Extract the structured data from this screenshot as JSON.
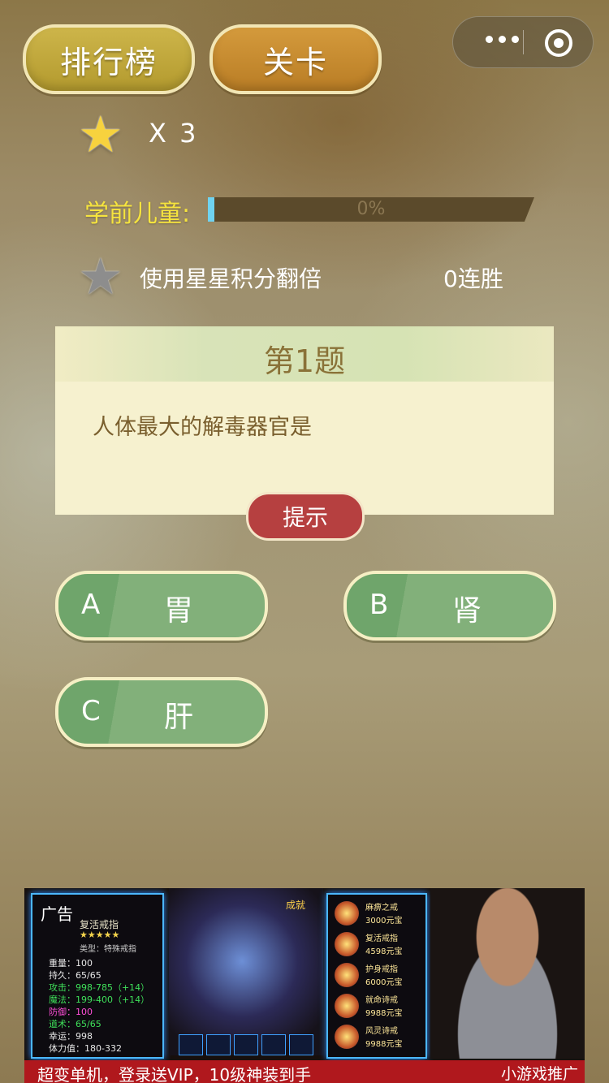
{
  "header": {
    "rank_label": "排行榜",
    "level_label": "关卡"
  },
  "capsule": {
    "more_icon": "more-dots-icon",
    "close_icon": "target-circle-icon"
  },
  "status": {
    "star_count": "X 3",
    "level_name": "学前儿童:",
    "progress_text": "0%",
    "progress_value": 0,
    "double_text": "使用星星积分翻倍",
    "streak_text": "0连胜"
  },
  "question": {
    "title": "第1题",
    "text": "人体最大的解毒器官是",
    "hint_label": "提示"
  },
  "answers": [
    {
      "letter": "A",
      "word": "胃"
    },
    {
      "letter": "B",
      "word": "肾"
    },
    {
      "letter": "C",
      "word": "肝"
    }
  ],
  "ad": {
    "label": "广告",
    "item_name": "复活戒指",
    "stars": "★★★★★",
    "item_type": "类型：特殊戒指",
    "stats": [
      {
        "text": "重量：100",
        "color": "#e6e6e6"
      },
      {
        "text": "持久：65/65",
        "color": "#e6e6e6"
      },
      {
        "text": "攻击：998-785（+14）",
        "color": "#3fe05a"
      },
      {
        "text": "魔法：199-400（+14）",
        "color": "#3fe05a"
      },
      {
        "text": "防御：100",
        "color": "#ff4fd8"
      },
      {
        "text": "道术：65/65",
        "color": "#3fe05a"
      },
      {
        "text": "幸运：998",
        "color": "#e6e6e6"
      },
      {
        "text": "体力值：180-332",
        "color": "#e6e6e6"
      }
    ],
    "tag": "成就",
    "shop": [
      {
        "name": "麻痹之戒",
        "price": "3000元宝"
      },
      {
        "name": "复活戒指",
        "price": "4598元宝"
      },
      {
        "name": "护身戒指",
        "price": "6000元宝"
      },
      {
        "name": "就命诗戒",
        "price": "9988元宝"
      },
      {
        "name": "风灵诗戒",
        "price": "9988元宝"
      }
    ],
    "slogan": "超变单机，登录送VIP，10级神装到手",
    "promo": "小游戏推广"
  }
}
